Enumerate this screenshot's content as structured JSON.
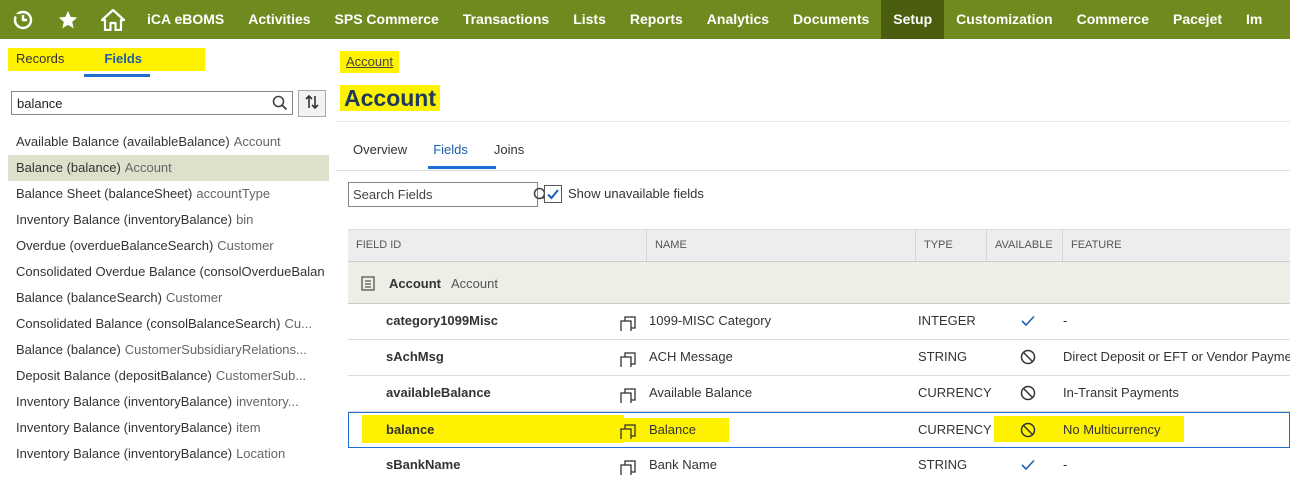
{
  "nav": {
    "icons": [
      "recent-icon",
      "star-icon",
      "home-icon"
    ],
    "items": [
      "iCA eBOMS",
      "Activities",
      "SPS Commerce",
      "Transactions",
      "Lists",
      "Reports",
      "Analytics",
      "Documents",
      "Setup",
      "Customization",
      "Commerce",
      "Pacejet",
      "Im"
    ],
    "active": "Setup"
  },
  "left": {
    "tabs": [
      "Records",
      "Fields"
    ],
    "active_tab": "Fields",
    "search_value": "balance",
    "results": [
      {
        "label": "Available Balance (availableBalance)",
        "sub": "Account"
      },
      {
        "label": "Balance (balance)",
        "sub": "Account"
      },
      {
        "label": "Balance Sheet (balanceSheet)",
        "sub": "accountType"
      },
      {
        "label": "Inventory Balance (inventoryBalance)",
        "sub": "bin"
      },
      {
        "label": "Overdue (overdueBalanceSearch)",
        "sub": "Customer"
      },
      {
        "label": "Consolidated Overdue Balance (consolOverdueBalan",
        "sub": ""
      },
      {
        "label": "Balance (balanceSearch)",
        "sub": "Customer"
      },
      {
        "label": "Consolidated Balance (consolBalanceSearch)",
        "sub": "Cu..."
      },
      {
        "label": "Balance (balance)",
        "sub": "CustomerSubsidiaryRelations..."
      },
      {
        "label": "Deposit Balance (depositBalance)",
        "sub": "CustomerSub..."
      },
      {
        "label": "Inventory Balance (inventoryBalance)",
        "sub": "inventory..."
      },
      {
        "label": "Inventory Balance (inventoryBalance)",
        "sub": "item"
      },
      {
        "label": "Inventory Balance (inventoryBalance)",
        "sub": "Location"
      }
    ]
  },
  "main": {
    "breadcrumb": "Account",
    "title": "Account",
    "tabs": [
      "Overview",
      "Fields",
      "Joins"
    ],
    "active_tab": "Fields",
    "search_placeholder": "Search Fields",
    "show_unavailable_label": "Show unavailable fields",
    "show_unavailable_checked": true,
    "columns": [
      "FIELD ID",
      "NAME",
      "TYPE",
      "AVAILABLE",
      "FEATURE"
    ],
    "group": {
      "name": "Account",
      "sub": "Account"
    },
    "rows": [
      {
        "field_id": "category1099Misc",
        "name": "1099-MISC Category",
        "type": "INTEGER",
        "available": "check-icon",
        "feature": "-"
      },
      {
        "field_id": "sAchMsg",
        "name": "ACH Message",
        "type": "STRING",
        "available": "no-icon",
        "feature": "Direct Deposit or EFT or Vendor Payme"
      },
      {
        "field_id": "availableBalance",
        "name": "Available Balance",
        "type": "CURRENCY",
        "available": "no-icon",
        "feature": "In-Transit Payments"
      },
      {
        "field_id": "balance",
        "name": "Balance",
        "type": "CURRENCY",
        "available": "no-icon",
        "feature": "No Multicurrency"
      },
      {
        "field_id": "sBankName",
        "name": "Bank Name",
        "type": "STRING",
        "available": "check-icon",
        "feature": "-"
      }
    ]
  },
  "colors": {
    "nav_bg": "#6f8b1f",
    "nav_active": "#4b5e10",
    "highlight": "#fff200",
    "link_blue": "#1a5fa8"
  }
}
